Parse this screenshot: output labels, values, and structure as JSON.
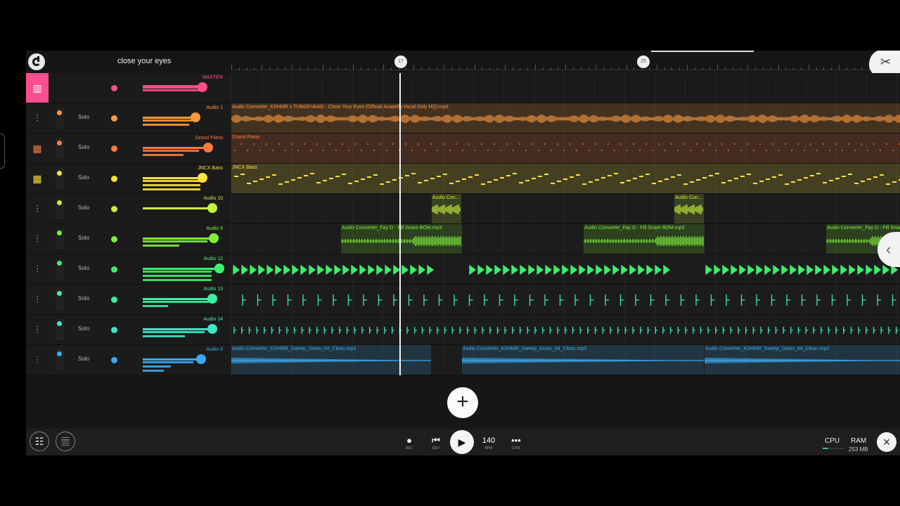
{
  "project": {
    "title": "close your eyes"
  },
  "header": {
    "logo_icon": "app-logo-icon",
    "cut_tool_icon": "scissors-icon",
    "markers": [
      {
        "label": "17"
      },
      {
        "label": "25"
      }
    ]
  },
  "tracks": [
    {
      "name": "MASTER",
      "color": "#ff4d8d",
      "icon": "mixer-bars-icon",
      "solo": "",
      "clips": []
    },
    {
      "name": "Audio 1",
      "color": "#ff9a3c",
      "icon": "waveform-icon",
      "solo": "Solo",
      "clips": [
        {
          "label": "Audio Converter_KSHMR x TUNGEVAAG - Close Your Eyes (Official Acapella Vocal Only HQ).mp3"
        }
      ]
    },
    {
      "name": "Grand Piano",
      "color": "#ff7a3c",
      "icon": "piano-keys-icon",
      "solo": "Solo",
      "clips": [
        {
          "label": "Grand Piano"
        }
      ]
    },
    {
      "name": "JNCX Bass",
      "color": "#ffe33c",
      "icon": "piano-keys-icon",
      "solo": "Solo",
      "clips": [
        {
          "label": "JNCX Bass"
        }
      ]
    },
    {
      "name": "Audio 10",
      "color": "#c6f23c",
      "icon": "waveform-icon",
      "solo": "Solo",
      "clips": [
        {
          "label": "Audio Con..."
        },
        {
          "label": "Audio Con..."
        }
      ]
    },
    {
      "name": "Audio 9",
      "color": "#7ef03c",
      "icon": "waveform-icon",
      "solo": "Solo",
      "clips": [
        {
          "label": "Audio Converter_Fay D - Fill Snare BOM.mp3"
        },
        {
          "label": "Audio Converter_Fay D - Fill Snare BOM.mp3"
        },
        {
          "label": "Audio Converter_Fay D - Fill Snare BOM.mp3"
        }
      ]
    },
    {
      "name": "Audio 12",
      "color": "#3cf06e",
      "icon": "waveform-icon",
      "solo": "Solo",
      "clips": []
    },
    {
      "name": "Audio 13",
      "color": "#3cf0a0",
      "icon": "waveform-icon",
      "solo": "Solo",
      "clips": []
    },
    {
      "name": "Audio 14",
      "color": "#3ce8c4",
      "icon": "waveform-icon",
      "solo": "Solo",
      "clips": []
    },
    {
      "name": "Audio 8",
      "color": "#3caaf0",
      "icon": "waveform-icon",
      "solo": "Solo",
      "clips": [
        {
          "label": "Audio Converter_KSHMR_Sweep_Down_04_Clean.mp3"
        },
        {
          "label": "Audio Converter_KSHMR_Sweep_Down_04_Clean.mp3"
        },
        {
          "label": "Audio Converter_KSHMR_Sweep_Down_04_Clean.mp3"
        }
      ]
    }
  ],
  "transport": {
    "rec_label": "REC",
    "rev_label": "REV",
    "bpm_value": "140",
    "bpm_label": "BPM",
    "ctrl_label": "CTRL",
    "play_icon": "play-icon"
  },
  "status": {
    "cpu_label": "CPU",
    "ram_label": "RAM",
    "ram_value": "253 MB",
    "cpu_level": 0.25
  },
  "add_track_icon": "plus-icon",
  "sidebar_handle_icon": "chevron-left-icon"
}
